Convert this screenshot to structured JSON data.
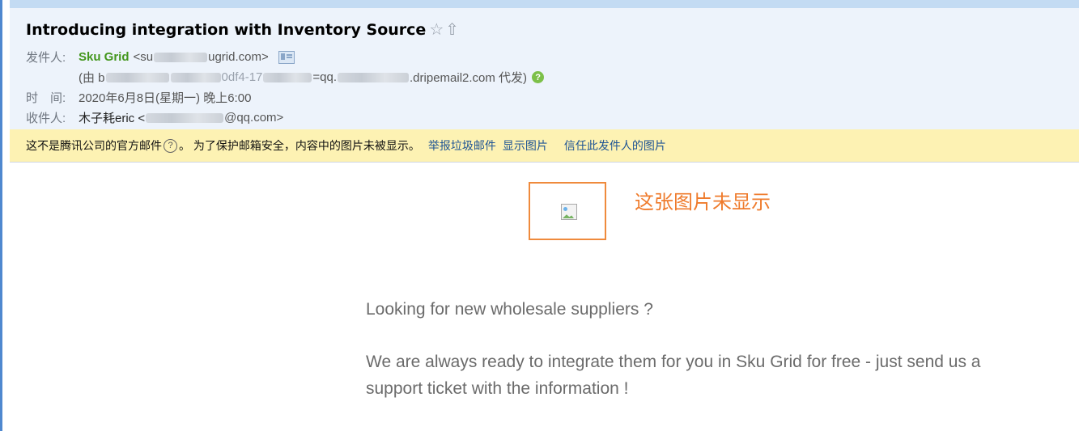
{
  "email": {
    "subject": "Introducing integration with Inventory Source",
    "from": {
      "label": "发件人:",
      "name": "Sku Grid",
      "email_prefix": "<su",
      "email_suffix": "ugrid.com>"
    },
    "on_behalf": {
      "prefix": "(由 b",
      "middle": "0df4-17",
      "mid2": "=qq.",
      "suffix": ".dripemail2.com 代发)"
    },
    "time": {
      "label": "时　间:",
      "value": "2020年6月8日(星期一) 晚上6:00"
    },
    "to": {
      "label": "收件人:",
      "name_prefix": "木子耗eric <",
      "email_suffix": "@qq.com>"
    }
  },
  "warning": {
    "text1": "这不是腾讯公司的官方邮件",
    "text2": "。 为了保护邮箱安全，内容中的图片未被显示。",
    "link_report": "举报垃圾邮件",
    "link_show": "显示图片",
    "link_trust": "信任此发件人的图片"
  },
  "content": {
    "image_note": "这张图片未显示",
    "para1": "Looking for new wholesale suppliers ?",
    "para2": "We are always ready to integrate them for you in Sku Grid for free - just send us a support ticket with the information !"
  },
  "icons": {
    "star": "star-outline-icon",
    "up": "up-arrow-icon",
    "contact": "contact-card-icon",
    "help": "question-icon"
  },
  "colors": {
    "accent_link": "#1e5494",
    "sender": "#43961c",
    "highlight_box": "#ef8a3c",
    "warning_bg": "#fdf2b3"
  }
}
